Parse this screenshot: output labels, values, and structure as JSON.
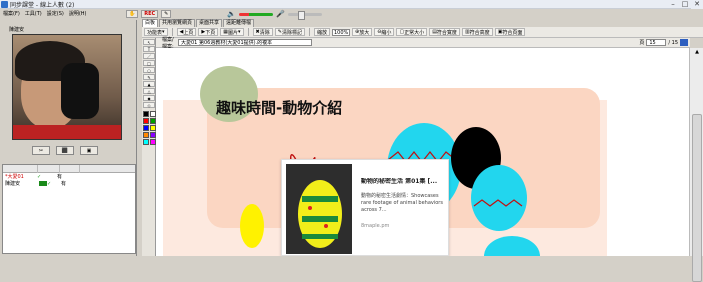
{
  "window": {
    "title": "同步課堂 - 線上人數 (2)",
    "controls": [
      "–",
      "□",
      "✕"
    ]
  },
  "menu": [
    "檔案(F)",
    "工具(T)",
    "設定(S)",
    "說明(H)"
  ],
  "toolbar": {
    "rec_label": "REC"
  },
  "video": {
    "label": "陳建安"
  },
  "video_buttons": [
    "✂",
    "⬛",
    "▣"
  ],
  "users": [
    {
      "name": "*大愛01",
      "mic": "✓",
      "perm": "有",
      "highlight": true
    },
    {
      "name": "陳建安",
      "mic": "✓",
      "perm": "有",
      "highlight": false
    }
  ],
  "tabs": [
    "白板",
    "共用瀏覽網頁",
    "桌面共享",
    "遠距離傳檔"
  ],
  "wb_toolbar": {
    "func_label": "功能表",
    "prev_label": "上頁",
    "next_label": "下頁",
    "image_label": "圖片",
    "clear_label": "清除",
    "clear_marks_label": "清除標記",
    "scale_label": "縮放",
    "zoom_value": "100%",
    "zoom_in_label": "放大",
    "zoom_out_label": "縮小",
    "actual_size_label": "正常大小",
    "fit_width_label": "符合寬度",
    "fit_height_label": "符合高度",
    "fit_page_label": "符合頁面"
  },
  "palette_tools": [
    "↖",
    "T",
    "／",
    "□",
    "○",
    "✎",
    "▲",
    "△",
    "◆",
    "◇"
  ],
  "palette_colors": [
    "#000000",
    "#ffffff",
    "#ff0000",
    "#00a000",
    "#0000ff",
    "#ffff00",
    "#ff8800",
    "#8800ff",
    "#00ffff",
    "#ff00ff"
  ],
  "filebar": {
    "label": "檔案/檔案:",
    "file": "大愛01 第06週教材(大愛01提供).的複本",
    "page_label": "頁",
    "page_value": "15",
    "page_total": "/ 15"
  },
  "slide": {
    "title": "趣味時間-動物介紹",
    "card_title": "動物的秘密生活 第01集 [...",
    "card_desc": "動物的秘密生活劇情：Showcases rare footage of animal behaviors across 7...",
    "card_source": "8maple.pm"
  }
}
